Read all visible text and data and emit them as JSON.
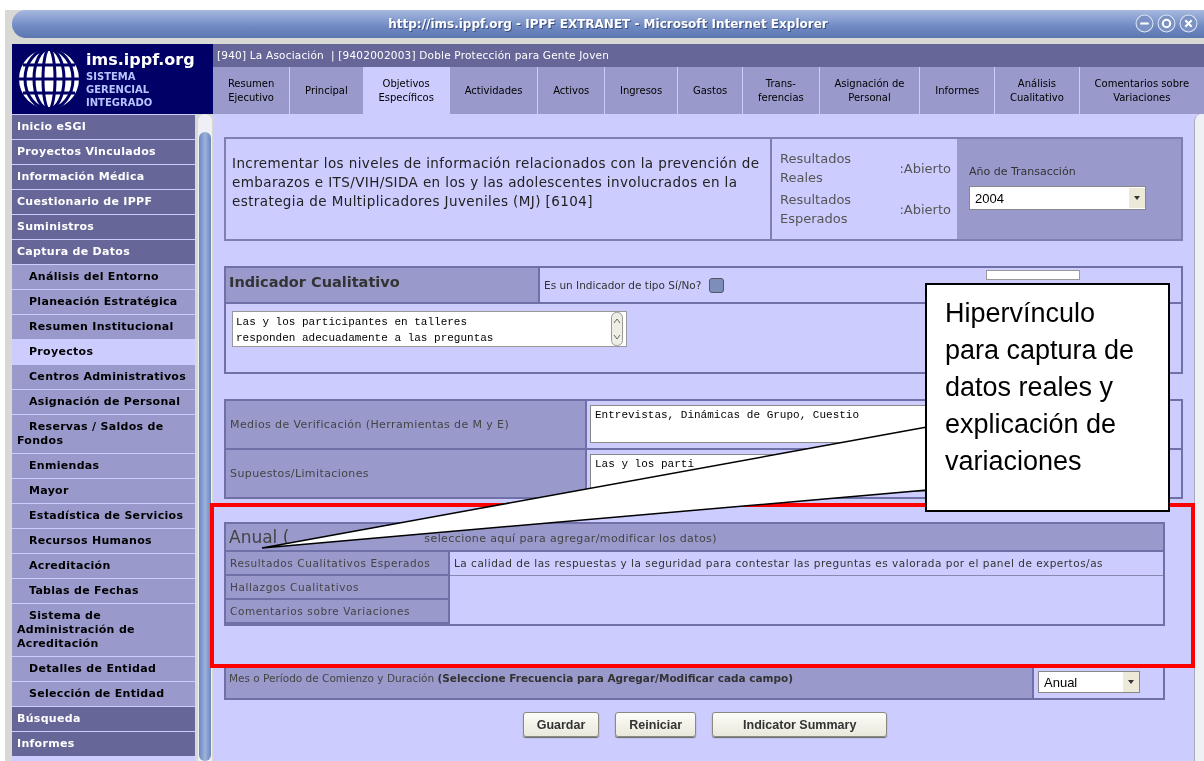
{
  "window": {
    "title": "http://ims.ippf.org - IPPF EXTRANET - Microsoft Internet Explorer"
  },
  "logo": {
    "domain": "ims.ippf.org",
    "subtitle": [
      "SISTEMA",
      "GERENCIAL",
      "INTEGRADO"
    ]
  },
  "breadcrumb": "[940] La Asociación  | [9402002003] Doble Protección para Gente Joven",
  "tabs": [
    {
      "label": "Resumen\nEjecutivo",
      "selected": false
    },
    {
      "label": "Principal",
      "selected": false
    },
    {
      "label": "Objetivos\nEspecíficos",
      "selected": true
    },
    {
      "label": "Actividades",
      "selected": false
    },
    {
      "label": "Activos",
      "selected": false
    },
    {
      "label": "Ingresos",
      "selected": false
    },
    {
      "label": "Gastos",
      "selected": false
    },
    {
      "label": "Trans-\nferencias",
      "selected": false
    },
    {
      "label": "Asignación de\nPersonal",
      "selected": false
    },
    {
      "label": "Informes",
      "selected": false
    },
    {
      "label": "Análisis\nCualitativo",
      "selected": false
    },
    {
      "label": "Comentarios sobre\nVariaciones",
      "selected": false
    }
  ],
  "sidebar": {
    "items": [
      {
        "label": "Inicio eSGI",
        "kind": "section",
        "selected": false
      },
      {
        "label": "Proyectos Vinculados",
        "kind": "section",
        "selected": false
      },
      {
        "label": "Información Médica",
        "kind": "section",
        "selected": false
      },
      {
        "label": "Cuestionario de IPPF",
        "kind": "section",
        "selected": false
      },
      {
        "label": "Suministros",
        "kind": "section",
        "selected": false
      },
      {
        "label": "Captura de Datos",
        "kind": "section",
        "selected": false
      },
      {
        "label": "Análisis del Entorno",
        "kind": "sub",
        "selected": false
      },
      {
        "label": "Planeación Estratégica",
        "kind": "sub",
        "selected": false
      },
      {
        "label": "Resumen Institucional",
        "kind": "sub",
        "selected": false
      },
      {
        "label": "Proyectos",
        "kind": "sub",
        "selected": true
      },
      {
        "label": "Centros Administrativos",
        "kind": "sub",
        "selected": false
      },
      {
        "label": "Asignación de Personal",
        "kind": "sub",
        "selected": false
      },
      {
        "label": "Reservas / Saldos de Fondos",
        "kind": "sub",
        "selected": false
      },
      {
        "label": "Enmiendas",
        "kind": "sub",
        "selected": false
      },
      {
        "label": "Mayor",
        "kind": "sub",
        "selected": false
      },
      {
        "label": "Estadística de Servicios",
        "kind": "sub",
        "selected": false
      },
      {
        "label": "Recursos Humanos",
        "kind": "sub",
        "selected": false
      },
      {
        "label": "Acreditación",
        "kind": "sub",
        "selected": false
      },
      {
        "label": "Tablas de Fechas",
        "kind": "sub",
        "selected": false
      },
      {
        "label": "Sistema de Administración de Acreditación",
        "kind": "sub",
        "selected": false
      },
      {
        "label": "Detalles de Entidad",
        "kind": "sub",
        "selected": false
      },
      {
        "label": "Selección de Entidad",
        "kind": "sub",
        "selected": false
      },
      {
        "label": "Búsqueda",
        "kind": "section",
        "selected": false
      },
      {
        "label": "Informes",
        "kind": "section",
        "selected": false
      }
    ]
  },
  "objective": {
    "text": "Incrementar los niveles de información relacionados con la prevención de embarazos e ITS/VIH/SIDA en los y las adolescentes involucrados en la estrategia de Multiplicadores Juveniles (MJ) [6104]",
    "statuses": [
      {
        "label": "Resultados Reales",
        "value": ":Abierto"
      },
      {
        "label": "Resultados Esperados",
        "value": ":Abierto"
      }
    ],
    "year_label": "Año de Transacción",
    "year": "2004"
  },
  "indicator": {
    "title": "Indicador Cualitativo",
    "question": "Es un Indicador de tipo Sí/No?",
    "checked": false,
    "text": "Las y los participantes en talleres\nresponden adecuadamente a las preguntas"
  },
  "fields": [
    {
      "label": "Medios de Verificación (Herramientas de M y E)",
      "value": "Entrevistas, Dinámicas de Grupo, Cuestio"
    },
    {
      "label": "Supuestos/Limitaciones",
      "value": "Las y los parti"
    }
  ],
  "annual": {
    "title": "Anual (",
    "hint": "seleccione aquí para agregar/modificar los datos)",
    "rows": [
      {
        "label": "Resultados Cualitativos Esperados",
        "value": "La calidad de las respuestas y la seguridad para contestar las preguntas es valorada por el panel de expertos/as"
      },
      {
        "label": "Hallazgos Cualitativos"
      },
      {
        "label": "Comentarios sobre Variaciones"
      }
    ]
  },
  "period": {
    "label": "Mes o Período de Comienzo y Duración **(Seleccione Frecuencia para Agregar/Modificar cada campo)**",
    "value": "Anual"
  },
  "buttons": [
    "Guardar",
    "Reiniciar",
    "Indicator Summary"
  ],
  "callout": {
    "text": "Hipervínculo para captura de datos reales y explicación de variaciones"
  }
}
